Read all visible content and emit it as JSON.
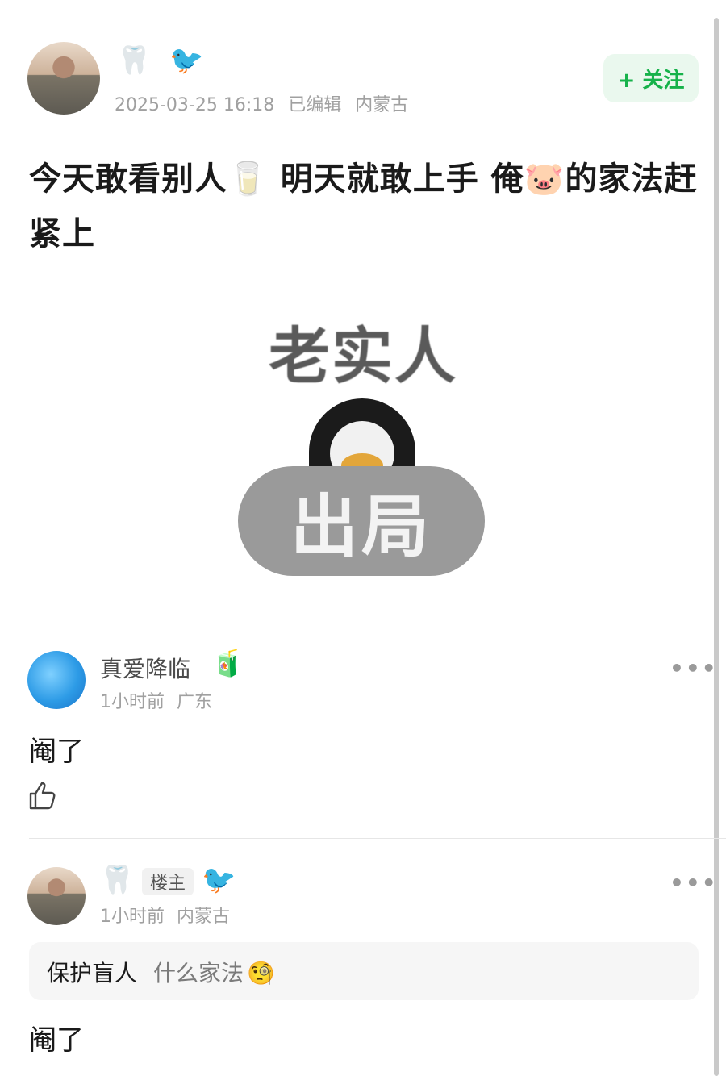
{
  "post": {
    "author_emojis": {
      "tooth": "🦷",
      "bird": "🐦"
    },
    "timestamp": "2025-03-25 16:18",
    "edited": "已编辑",
    "location": "内蒙古",
    "follow_label": "+ 关注",
    "text": "今天敢看别人🥛 明天就敢上手 俺🐷的家法赶紧上",
    "image": {
      "top_text": "老实人",
      "pill_text": "出局"
    }
  },
  "comments": [
    {
      "username": "真爱降临",
      "badge_emoji": "🧃",
      "time": "1小时前",
      "location": "广东",
      "text": "阉了",
      "more_label": "•••"
    },
    {
      "emoji_1": "🦷",
      "op_badge": "楼主",
      "emoji_2": "🐦",
      "time": "1小时前",
      "location": "内蒙古",
      "quote_author": "保护盲人",
      "quote_text": "什么家法",
      "quote_emoji": "🧐",
      "text": "阉了",
      "more_label": "•••"
    }
  ],
  "colors": {
    "accent_green": "#16b24a",
    "follow_bg": "#eaf8ee"
  }
}
